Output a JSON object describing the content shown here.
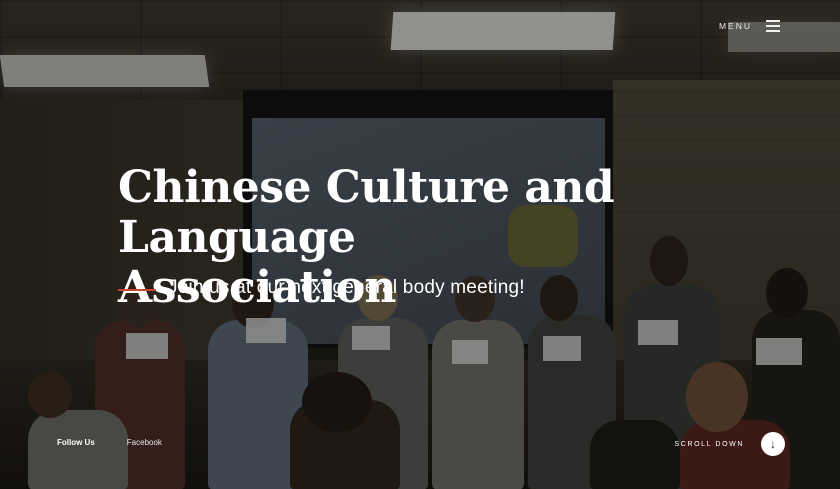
{
  "header": {
    "menu_label": "MENU",
    "menu_icon": "hamburger-icon"
  },
  "hero": {
    "title_line1": "Chinese Culture and",
    "title_line2": "Language Association",
    "subtitle": "Join us at our next general body meeting!",
    "accent_color": "#c8482e"
  },
  "footer": {
    "follow_label": "Follow Us",
    "facebook_label": "Facebook",
    "scroll_label": "SCROLL DOWN",
    "scroll_icon": "arrow-down-icon"
  }
}
